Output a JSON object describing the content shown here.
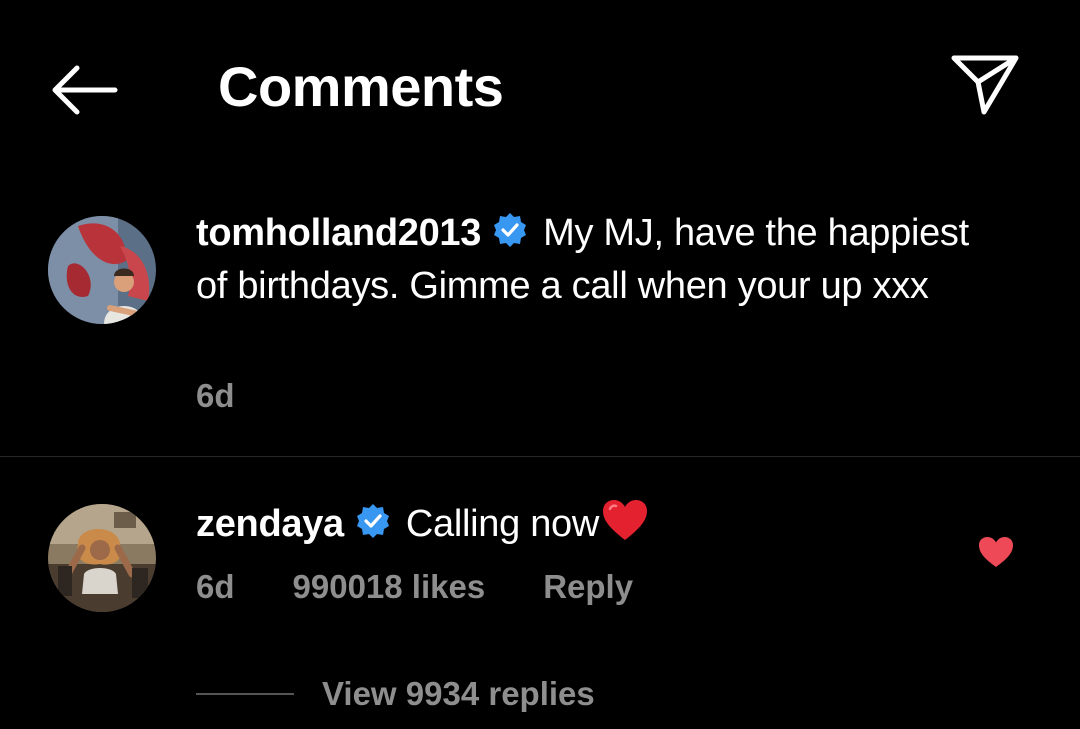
{
  "header": {
    "title": "Comments",
    "back_icon": "arrow-left-icon",
    "share_icon": "paper-plane-icon"
  },
  "caption": {
    "username": "tomholland2013",
    "verified": true,
    "text": "My MJ, have the happiest of birthdays. Gimme a call when your up xxx",
    "time": "6d"
  },
  "comments": [
    {
      "username": "zendaya",
      "verified": true,
      "text": "Calling now",
      "emoji": "red-heart-emoji",
      "time": "6d",
      "likes": "990018 likes",
      "reply_label": "Reply",
      "liked": true,
      "view_replies": "View 9934 replies"
    }
  ],
  "colors": {
    "background": "#000000",
    "text": "#ffffff",
    "secondary_text": "#8e8e8e",
    "verified_badge": "#3897f0",
    "like_heart": "#ed4956",
    "divider": "#262626"
  }
}
